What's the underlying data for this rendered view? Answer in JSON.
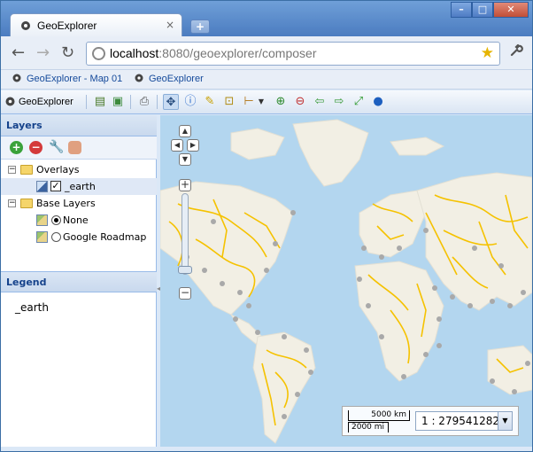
{
  "browser": {
    "tab_title": "GeoExplorer",
    "tab_close": "×",
    "new_tab": "+",
    "window": {
      "minimize": "–",
      "maximize": "□",
      "close": "✕"
    },
    "url_host": "localhost",
    "url_rest": ":8080/geoexplorer/composer",
    "back": "←",
    "forward": "→",
    "reload": "↻",
    "star": "★",
    "wrench": "🔧",
    "bookmarks": [
      "GeoExplorer - Map 01",
      "GeoExplorer"
    ]
  },
  "app_toolbar": {
    "title": "GeoExplorer",
    "tools": [
      {
        "icon": "page-icon",
        "glyph": "▤"
      },
      {
        "icon": "export-map-icon",
        "glyph": "▣"
      },
      {
        "icon": "print-icon",
        "glyph": "⎙"
      },
      {
        "icon": "pan-icon",
        "glyph": "✥"
      },
      {
        "icon": "info-icon",
        "glyph": "ⓘ"
      },
      {
        "icon": "measure-icon",
        "glyph": "✎"
      },
      {
        "icon": "measure-area-icon",
        "glyph": "⊡"
      },
      {
        "icon": "measure-menu-icon",
        "glyph": "⊢"
      },
      {
        "icon": "zoom-in-icon",
        "glyph": "⊕"
      },
      {
        "icon": "zoom-out-icon",
        "glyph": "⊖"
      },
      {
        "icon": "previous-extent-icon",
        "glyph": "⇦"
      },
      {
        "icon": "next-extent-icon",
        "glyph": "⇨"
      },
      {
        "icon": "max-extent-icon",
        "glyph": "⤢"
      },
      {
        "icon": "google-earth-icon",
        "glyph": "●"
      }
    ]
  },
  "layers_panel": {
    "title": "Layers",
    "tree": {
      "overlays_label": "Overlays",
      "overlay_layer": "_earth",
      "base_label": "Base Layers",
      "base_layers": [
        {
          "label": "None",
          "selected": true
        },
        {
          "label": "Google Roadmap",
          "selected": false
        }
      ]
    }
  },
  "legend_panel": {
    "title": "Legend",
    "entry": "_earth"
  },
  "map": {
    "scale_km": "5000 km",
    "scale_mi": "2000 mi",
    "scale_value": "1 : 279541282"
  },
  "colors": {
    "accent": "#15428b",
    "ocean": "#b3d6ef",
    "land": "#f2efe4",
    "rivers": "#f5c200",
    "points": "#a9a9a9"
  }
}
